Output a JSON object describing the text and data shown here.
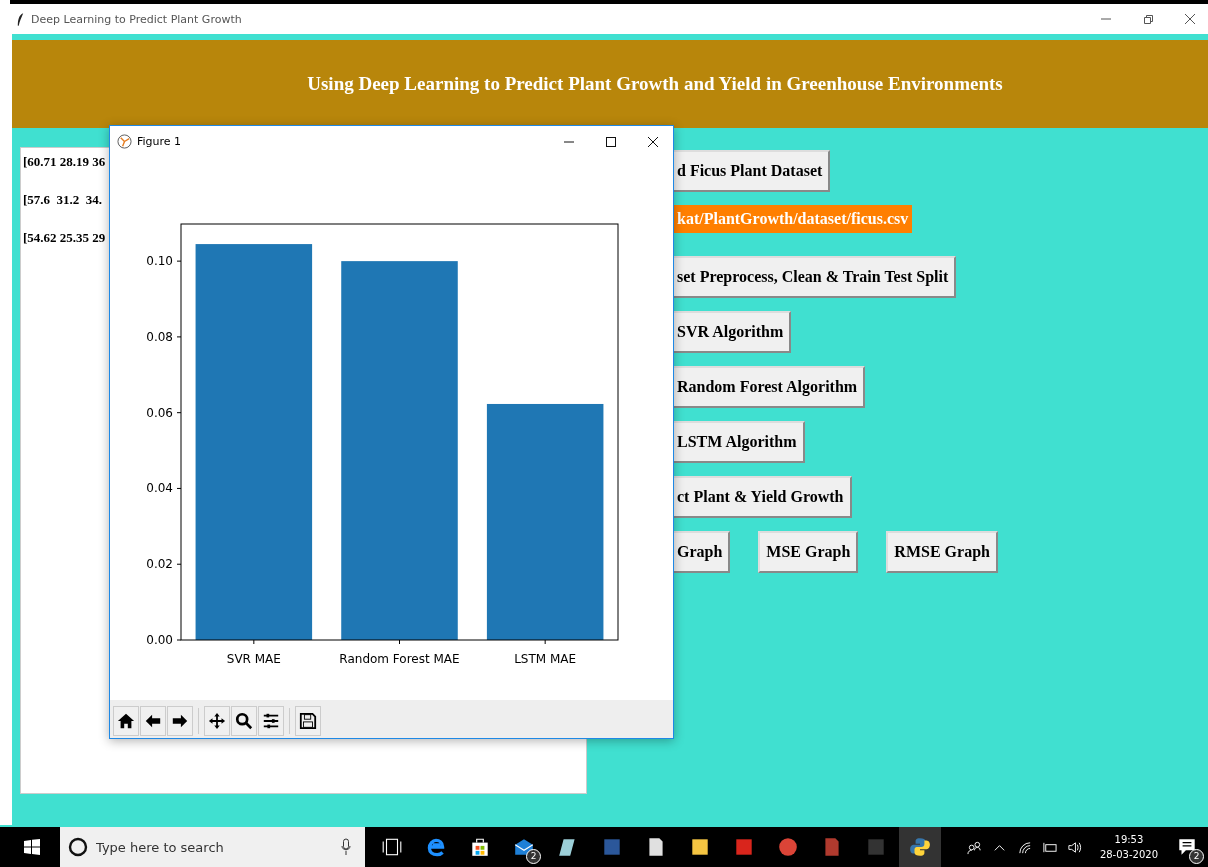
{
  "window": {
    "title": "Deep Learning to Predict Plant Growth"
  },
  "header": {
    "title": "Using Deep Learning to Predict Plant Growth and Yield in Greenhouse Environments"
  },
  "output_lines": [
    "[60.71 28.19 36",
    "[57.6  31.2  34.",
    "[54.62 25.35 29"
  ],
  "controls": [
    {
      "kind": "button",
      "label": "d Ficus Plant Dataset"
    },
    {
      "kind": "path",
      "label": "kat/PlantGrowth/dataset/ficus.csv"
    },
    {
      "kind": "button",
      "label": "set Preprocess, Clean & Train Test Split"
    },
    {
      "kind": "button",
      "label": "SVR Algorithm"
    },
    {
      "kind": "button",
      "label": "Random Forest Algorithm"
    },
    {
      "kind": "button",
      "label": "LSTM Algorithm"
    },
    {
      "kind": "button",
      "label": "ct Plant & Yield Growth"
    }
  ],
  "graph_buttons": [
    "Graph",
    "MSE Graph",
    "RMSE Graph"
  ],
  "figure": {
    "title": "Figure 1",
    "chart_data": {
      "type": "bar",
      "categories": [
        "SVR MAE",
        "Random Forest MAE",
        "LSTM MAE"
      ],
      "values": [
        0.1045,
        0.1,
        0.0623
      ],
      "ylim": [
        0,
        0.1098
      ],
      "yticks": [
        {
          "value": 0,
          "label": "0.00"
        },
        {
          "value": 0.02,
          "label": "0.02"
        },
        {
          "value": 0.04,
          "label": "0.04"
        },
        {
          "value": 0.06,
          "label": "0.06"
        },
        {
          "value": 0.08,
          "label": "0.08"
        },
        {
          "value": 0.1,
          "label": "0.10"
        }
      ]
    }
  },
  "taskbar": {
    "search": {
      "placeholder": "Type here to search"
    },
    "mail_badge": "2",
    "time": "19:53",
    "date": "28-03-2020",
    "notification_badge": "2"
  }
}
